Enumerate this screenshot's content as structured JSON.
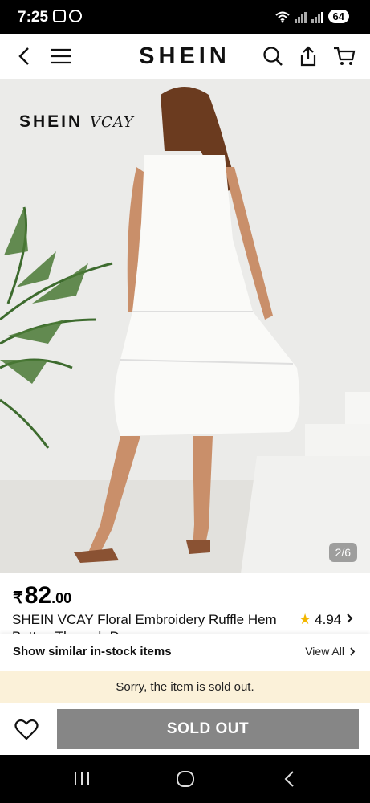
{
  "status_bar": {
    "time": "7:25",
    "battery": "64"
  },
  "header": {
    "brand": "SHEIN"
  },
  "product": {
    "image_logo_main": "SHEIN ",
    "image_logo_sub": "VCAY",
    "image_counter": "2/6",
    "price_currency": "₹",
    "price_main": "82",
    "price_decimal": ".00",
    "title": "SHEIN VCAY Floral Embroidery Ruffle Hem Button Through Dress",
    "rating": "4.94"
  },
  "similar": {
    "title": "Show similar in-stock items",
    "view_all": "View All"
  },
  "notice": "Sorry, the item is sold out.",
  "actions": {
    "sold_out": "SOLD OUT"
  },
  "icons": {
    "back": "back-arrow-icon",
    "menu": "menu-icon",
    "search": "search-icon",
    "share": "share-icon",
    "cart": "cart-icon",
    "star": "star-icon",
    "wishlist": "heart-icon"
  },
  "colors": {
    "sold_out_button": "#868686",
    "notice_bg": "#fbf1d9",
    "star": "#f2b600"
  }
}
